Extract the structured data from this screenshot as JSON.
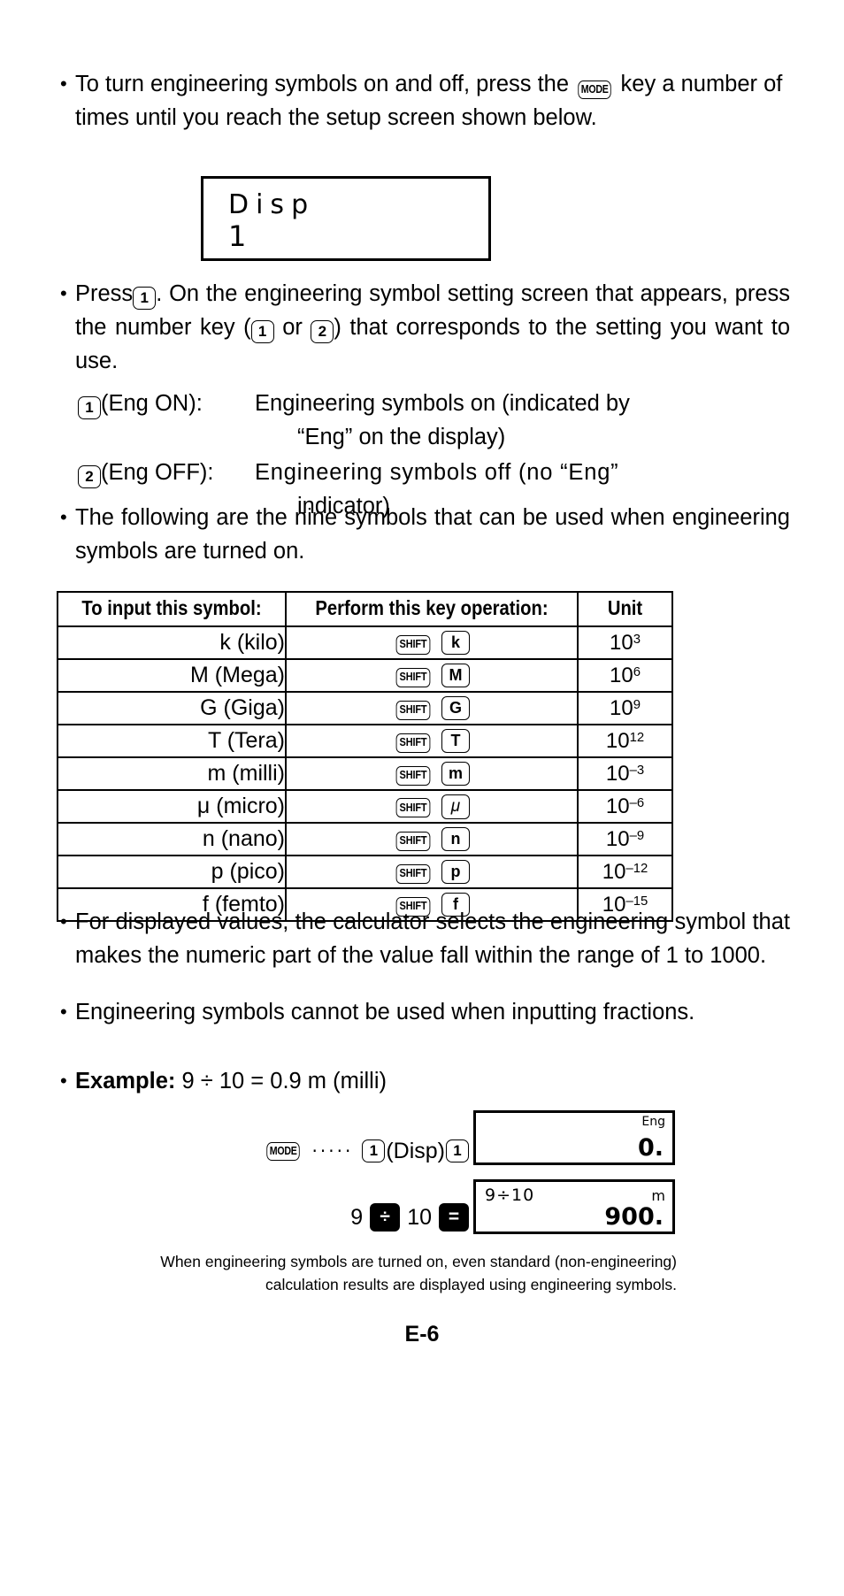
{
  "intro": {
    "bullet1_pre": "To turn engineering symbols on and off, press the",
    "bullet1_key": "MODE",
    "bullet1_post": "key a number of times until you reach the setup screen shown below."
  },
  "setup_screen": {
    "line1": "Disp",
    "line2": "1"
  },
  "press_bullet": {
    "part1": "Press",
    "key1": "1",
    "part2": ". On the engineering symbol setting screen that appears, press the number key (",
    "key2": "1",
    "part3": "or",
    "key3": "2",
    "part4": ") that corresponds to the setting you want to use."
  },
  "settings": [
    {
      "key": "1",
      "label": "(Eng ON):",
      "desc_line1": "Engineering symbols on (indicated by",
      "desc_line2": "“Eng” on the display)"
    },
    {
      "key": "2",
      "label": "(Eng OFF):",
      "desc_line1": "Engineering symbols off (no “Eng”",
      "desc_line2": "indicator)"
    }
  ],
  "nine_symbols_bullet": "The following are the nine symbols that can be used when engineering symbols are turned on.",
  "table": {
    "headers": [
      "To input this symbol:",
      "Perform this key operation:",
      "Unit"
    ],
    "shift_key_label": "SHIFT",
    "rows": [
      {
        "symbol": "k (kilo)",
        "key": "k",
        "key_italic": false,
        "unit_base": "10",
        "unit_exp": "3"
      },
      {
        "symbol": "M (Mega)",
        "key": "M",
        "key_italic": false,
        "unit_base": "10",
        "unit_exp": "6"
      },
      {
        "symbol": "G (Giga)",
        "key": "G",
        "key_italic": false,
        "unit_base": "10",
        "unit_exp": "9"
      },
      {
        "symbol": "T (Tera)",
        "key": "T",
        "key_italic": false,
        "unit_base": "10",
        "unit_exp": "12"
      },
      {
        "symbol": "m (milli)",
        "key": "m",
        "key_italic": false,
        "unit_base": "10",
        "unit_exp": "–3"
      },
      {
        "symbol": "μ (micro)",
        "key": "μ",
        "key_italic": true,
        "unit_base": "10",
        "unit_exp": "–6"
      },
      {
        "symbol": "n (nano)",
        "key": "n",
        "key_italic": false,
        "unit_base": "10",
        "unit_exp": "–9"
      },
      {
        "symbol": "p (pico)",
        "key": "p",
        "key_italic": false,
        "unit_base": "10",
        "unit_exp": "–12"
      },
      {
        "symbol": "f (femto)",
        "key": "f",
        "key_italic": false,
        "unit_base": "10",
        "unit_exp": "–15"
      }
    ]
  },
  "after_table_bullets": [
    "For displayed values, the calculator selects the engineering symbol that makes the numeric part of the value fall within the range of 1 to 1000.",
    "Engineering symbols cannot be used when inputting fractions."
  ],
  "example": {
    "label": "Example:",
    "expression": "9 ÷ 10 = 0.9 m (milli)",
    "step1": {
      "key_mode": "MODE",
      "dots": "·····",
      "key_1a": "1",
      "disp_text": "(Disp)",
      "key_1b": "1",
      "screen": {
        "indicator": "Eng",
        "result": "0."
      }
    },
    "step2": {
      "operand1": "9",
      "key_divide": "÷",
      "operand2": "10",
      "key_equals": "=",
      "screen": {
        "entry": "9÷10",
        "unit": "m",
        "result": "900."
      }
    }
  },
  "footnote": "When engineering symbols are turned on, even standard (non-engineering) calculation results are displayed using engineering symbols.",
  "page_number": "E-6"
}
